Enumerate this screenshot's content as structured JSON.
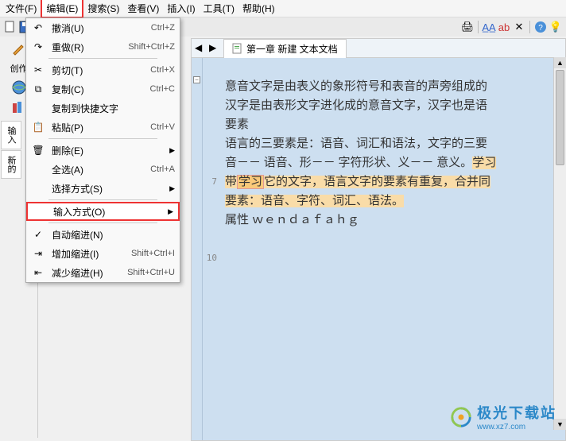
{
  "menubar": {
    "file": "文件(F)",
    "edit": "编辑(E)",
    "search": "搜索(S)",
    "view": "查看(V)",
    "insert": "插入(I)",
    "tools": "工具(T)",
    "help": "帮助(H)"
  },
  "dropdown": {
    "undo": {
      "label": "撤消(U)",
      "shortcut": "Ctrl+Z"
    },
    "redo": {
      "label": "重做(R)",
      "shortcut": "Shift+Ctrl+Z"
    },
    "cut": {
      "label": "剪切(T)",
      "shortcut": "Ctrl+X"
    },
    "copy": {
      "label": "复制(C)",
      "shortcut": "Ctrl+C"
    },
    "copy_quick": {
      "label": "复制到快捷文字"
    },
    "paste": {
      "label": "粘贴(P)",
      "shortcut": "Ctrl+V"
    },
    "delete": {
      "label": "删除(E)"
    },
    "select_all": {
      "label": "全选(A)",
      "shortcut": "Ctrl+A"
    },
    "select_mode": {
      "label": "选择方式(S)"
    },
    "input_mode": {
      "label": "输入方式(O)"
    },
    "auto_indent": {
      "label": "自动缩进(N)"
    },
    "inc_indent": {
      "label": "增加缩进(I)",
      "shortcut": "Shift+Ctrl+I"
    },
    "dec_indent": {
      "label": "减少缩进(H)",
      "shortcut": "Shift+Ctrl+U"
    }
  },
  "sidebar": {
    "create": "创作",
    "input": "输入",
    "new": "新的"
  },
  "tab": {
    "title": "第一章 新建 文本文档"
  },
  "lines": {
    "l2": "意音文字是由表义的象形符号和表音的声旁组成的",
    "l3": "汉字是由表形文字进化成的意音文字，汉字也是语",
    "l4": "要素",
    "l5": "语言的三要素是：语音、词汇和语法，文字的三要",
    "l6_a": "音－－ 语音、形－－ 字符形状、义－－ 意义。",
    "l6_b": "学习",
    "l7_a": "带",
    "l7_b": "学习",
    "l7_c": "它的文字，语言文字的要素有重复，合并同",
    "l8": "要素：语音、字符、词汇、语法。",
    "l9_a": "属性  ",
    "l9_b": "ｗｅｎｄａｆａｈｇ"
  },
  "gutter": {
    "n7": "7",
    "n10": "10"
  },
  "logo": {
    "text": "极光下载站",
    "url": "www.xz7.com"
  }
}
